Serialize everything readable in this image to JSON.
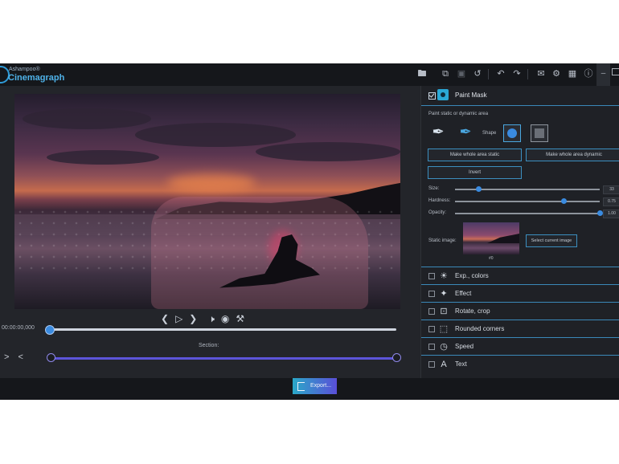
{
  "app": {
    "brand": "Ashampoo®",
    "name": "Cinemagraph"
  },
  "toolbar": {
    "icons": [
      "folder-icon",
      "copy-icon",
      "trash-icon",
      "reset-icon",
      "undo-icon",
      "redo-icon",
      "chat-icon",
      "gear-icon",
      "image-icon",
      "info-icon"
    ],
    "minimize": "–"
  },
  "player": {
    "time": "00:00:00,000",
    "section_label": "Section:",
    "section_nav": "> <",
    "progress_fraction": 0.0
  },
  "paint_mask": {
    "title": "Paint Mask",
    "subtitle": "Paint static or dynamic area",
    "shape_label": "Shape",
    "btn_static": "Make whole area static",
    "btn_dynamic": "Make whole area dynamic",
    "btn_invert": "Invert",
    "sliders": [
      {
        "label": "Size:",
        "value": "33",
        "fraction": 0.16
      },
      {
        "label": "Hardness:",
        "value": "0.75",
        "fraction": 0.75
      },
      {
        "label": "Opacity:",
        "value": "1.00",
        "fraction": 1.0
      }
    ],
    "static_image_label": "Static image:",
    "static_image_caption": "#0",
    "btn_select_image": "Select current image"
  },
  "sections": [
    {
      "label": "Exp., colors",
      "icon": "sun-icon"
    },
    {
      "label": "Effect",
      "icon": "effect-icon"
    },
    {
      "label": "Rotate, crop",
      "icon": "crop-icon"
    },
    {
      "label": "Rounded corners",
      "icon": "corners-icon"
    },
    {
      "label": "Speed",
      "icon": "speed-icon"
    },
    {
      "label": "Text",
      "icon": "text-icon"
    }
  ],
  "footer": {
    "export_label": "Export..."
  }
}
